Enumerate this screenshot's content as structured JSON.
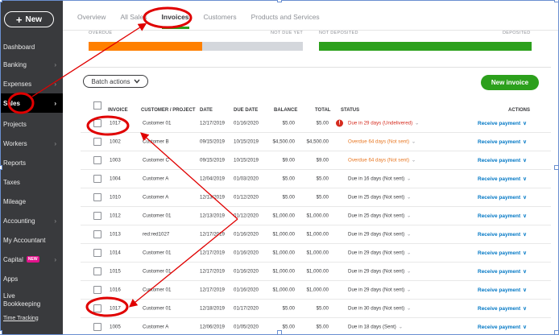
{
  "sidebar": {
    "new_label": "New",
    "items": [
      {
        "label": "Dashboard",
        "chev": false
      },
      {
        "label": "Banking",
        "chev": true
      },
      {
        "label": "Expenses",
        "chev": true
      },
      {
        "label": "Sales",
        "chev": true,
        "active": true
      },
      {
        "label": "Projects",
        "chev": false
      },
      {
        "label": "Workers",
        "chev": true
      },
      {
        "label": "Reports",
        "chev": false
      },
      {
        "label": "Taxes",
        "chev": false
      },
      {
        "label": "Mileage",
        "chev": false
      },
      {
        "label": "Accounting",
        "chev": true
      },
      {
        "label": "My Accountant",
        "chev": false
      },
      {
        "label": "Capital",
        "chev": true,
        "badge": "NEW"
      },
      {
        "label": "Apps",
        "chev": false
      }
    ],
    "live_line1": "Live",
    "live_line2": "Bookkeeping",
    "time_tracking": "Time Tracking"
  },
  "tabs": [
    "Overview",
    "All Sales",
    "Invoices",
    "Customers",
    "Products and Services"
  ],
  "active_tab": "Invoices",
  "summary": {
    "overdue": "OVERDUE",
    "not_due_yet": "NOT DUE YET",
    "not_deposited": "NOT DEPOSITED",
    "deposited": "DEPOSITED",
    "overdue_fraction": 0.53
  },
  "toolbar": {
    "batch_actions": "Batch actions",
    "new_invoice": "New invoice"
  },
  "table": {
    "headers": {
      "invoice": "INVOICE",
      "customer": "CUSTOMER / PROJECT",
      "date": "DATE",
      "due_date": "DUE DATE",
      "balance": "BALANCE",
      "total": "TOTAL",
      "status": "STATUS",
      "actions": "ACTIONS"
    },
    "rows": [
      {
        "invoice": "1017",
        "customer": "Customer 01",
        "date": "12/17/2019",
        "due": "01/16/2020",
        "balance": "$5.00",
        "total": "$5.00",
        "status": "Due in 29 days (Undelivered)",
        "tone": "red",
        "alert": true,
        "action": "Receive payment"
      },
      {
        "invoice": "1002",
        "customer": "Customer B",
        "date": "09/15/2019",
        "due": "10/15/2019",
        "balance": "$4,500.00",
        "total": "$4,500.00",
        "status": "Overdue 64 days (Not sent)",
        "tone": "orange",
        "action": "Receive payment"
      },
      {
        "invoice": "1003",
        "customer": "Customer C",
        "date": "09/15/2019",
        "due": "10/15/2019",
        "balance": "$9.00",
        "total": "$9.00",
        "status": "Overdue 64 days (Not sent)",
        "tone": "orange",
        "action": "Receive payment"
      },
      {
        "invoice": "1004",
        "customer": "Customer A",
        "date": "12/04/2019",
        "due": "01/03/2020",
        "balance": "$5.00",
        "total": "$5.00",
        "status": "Due in 16 days (Not sent)",
        "tone": "normal",
        "action": "Receive payment"
      },
      {
        "invoice": "1010",
        "customer": "Customer A",
        "date": "12/13/2019",
        "due": "01/12/2020",
        "balance": "$5.00",
        "total": "$5.00",
        "status": "Due in 25 days (Not sent)",
        "tone": "normal",
        "action": "Receive payment"
      },
      {
        "invoice": "1012",
        "customer": "Customer 01",
        "date": "12/13/2019",
        "due": "01/12/2020",
        "balance": "$1,000.00",
        "total": "$1,000.00",
        "status": "Due in 25 days (Not sent)",
        "tone": "normal",
        "action": "Receive payment"
      },
      {
        "invoice": "1013",
        "customer": "red:red1027",
        "date": "12/17/2019",
        "due": "01/16/2020",
        "balance": "$1,000.00",
        "total": "$1,000.00",
        "status": "Due in 29 days (Not sent)",
        "tone": "normal",
        "action": "Receive payment"
      },
      {
        "invoice": "1014",
        "customer": "Customer 01",
        "date": "12/17/2019",
        "due": "01/16/2020",
        "balance": "$1,000.00",
        "total": "$1,000.00",
        "status": "Due in 29 days (Not sent)",
        "tone": "normal",
        "action": "Receive payment"
      },
      {
        "invoice": "1015",
        "customer": "Customer 01",
        "date": "12/17/2019",
        "due": "01/16/2020",
        "balance": "$1,000.00",
        "total": "$1,000.00",
        "status": "Due in 29 days (Not sent)",
        "tone": "normal",
        "action": "Receive payment"
      },
      {
        "invoice": "1016",
        "customer": "Customer 01",
        "date": "12/17/2019",
        "due": "01/16/2020",
        "balance": "$1,000.00",
        "total": "$1,000.00",
        "status": "Due in 29 days (Not sent)",
        "tone": "normal",
        "action": "Receive payment"
      },
      {
        "invoice": "1017",
        "customer": "Customer 01",
        "date": "12/18/2019",
        "due": "01/17/2020",
        "balance": "$5.00",
        "total": "$5.00",
        "status": "Due in 30 days (Not sent)",
        "tone": "normal",
        "action": "Receive payment"
      },
      {
        "invoice": "1005",
        "customer": "Customer A",
        "date": "12/06/2019",
        "due": "01/05/2020",
        "balance": "$5.00",
        "total": "$5.00",
        "status": "Due in 18 days (Sent)",
        "tone": "normal",
        "action": "Receive payment"
      }
    ]
  },
  "colors": {
    "sidebar_bg": "#393a3d",
    "accent_green": "#2ca01c",
    "overdue_orange": "#ff8000",
    "link_blue": "#0077c5",
    "annotation_red": "#e00000"
  }
}
